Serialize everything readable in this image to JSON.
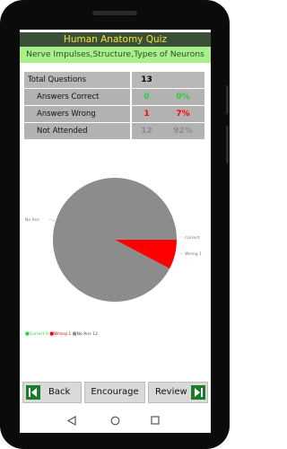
{
  "header": {
    "title": "Human Anatomy Quiz",
    "subtitle": "Nerve Impulses,Structure,Types of Neurons"
  },
  "stats": {
    "total": {
      "label": "Total Questions",
      "value": "13"
    },
    "correct": {
      "label": "Answers Correct",
      "count": "0",
      "percent": "0%"
    },
    "wrong": {
      "label": "Answers Wrong",
      "count": "1",
      "percent": "7%"
    },
    "not_attended": {
      "label": "Not Attended",
      "count": "12",
      "percent": "92%"
    }
  },
  "chart_data": {
    "type": "pie",
    "slices": [
      {
        "label": "Correct",
        "value": 0,
        "color": "#2ecc40"
      },
      {
        "label": "Wrong 1",
        "value": 1,
        "color": "#ff0000"
      },
      {
        "label": "No Ans",
        "value": 12,
        "color": "#8c8c8c"
      }
    ],
    "legend": [
      "Correct 0",
      "Wrong 1",
      "No Ans 12"
    ],
    "slice_labels": {
      "no_ans": "No Ans",
      "correct": "Correct",
      "wrong": "Wrong 1"
    }
  },
  "buttons": {
    "back": "Back",
    "encourage": "Encourage",
    "review": "Review"
  },
  "colors": {
    "title_bg": "#3b4f37",
    "title_text": "#f0e63a",
    "subtitle_bg": "#a9f08a",
    "correct": "#2ecc40",
    "wrong": "#ff0000",
    "not_attended": "#8c8c8c",
    "icon_green": "#1b7b2c"
  },
  "nav": {
    "back_icon": "triangle-back-icon",
    "home_icon": "circle-home-icon",
    "recents_icon": "square-recents-icon"
  }
}
